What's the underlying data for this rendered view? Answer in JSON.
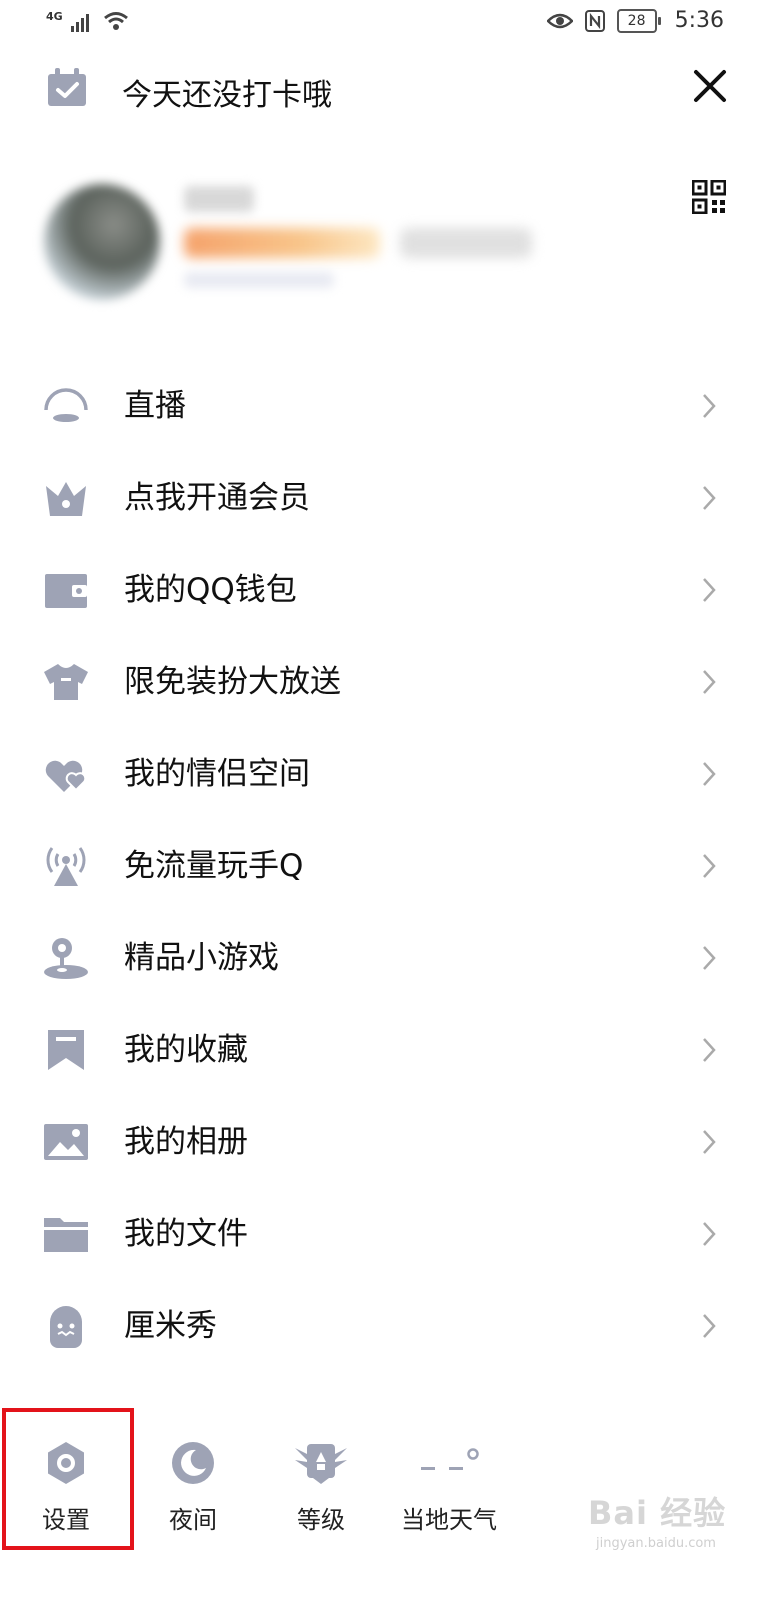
{
  "status_bar": {
    "network": "4G",
    "battery": "28",
    "time": "5:36"
  },
  "header": {
    "checkin_text": "今天还没打卡哦"
  },
  "menu": {
    "items": [
      {
        "label": "直播",
        "icon": "live-icon"
      },
      {
        "label": "点我开通会员",
        "icon": "crown-icon"
      },
      {
        "label": "我的QQ钱包",
        "icon": "wallet-icon"
      },
      {
        "label": "限免装扮大放送",
        "icon": "shirt-icon"
      },
      {
        "label": "我的情侣空间",
        "icon": "hearts-icon"
      },
      {
        "label": "免流量玩手Q",
        "icon": "signal-tower-icon"
      },
      {
        "label": "精品小游戏",
        "icon": "joystick-icon"
      },
      {
        "label": "我的收藏",
        "icon": "bookmark-icon"
      },
      {
        "label": "我的相册",
        "icon": "photo-icon"
      },
      {
        "label": "我的文件",
        "icon": "folder-icon"
      },
      {
        "label": "厘米秀",
        "icon": "character-icon"
      }
    ]
  },
  "bottom_bar": {
    "settings": "设置",
    "night": "夜间",
    "level": "等级",
    "weather": "当地天气"
  },
  "watermark": {
    "brand": "Bai 经验",
    "url": "jingyan.baidu.com"
  },
  "colors": {
    "icon_gray": "#9ea3b5",
    "highlight_red": "#e3131a",
    "chevron": "#aaaaaa"
  }
}
